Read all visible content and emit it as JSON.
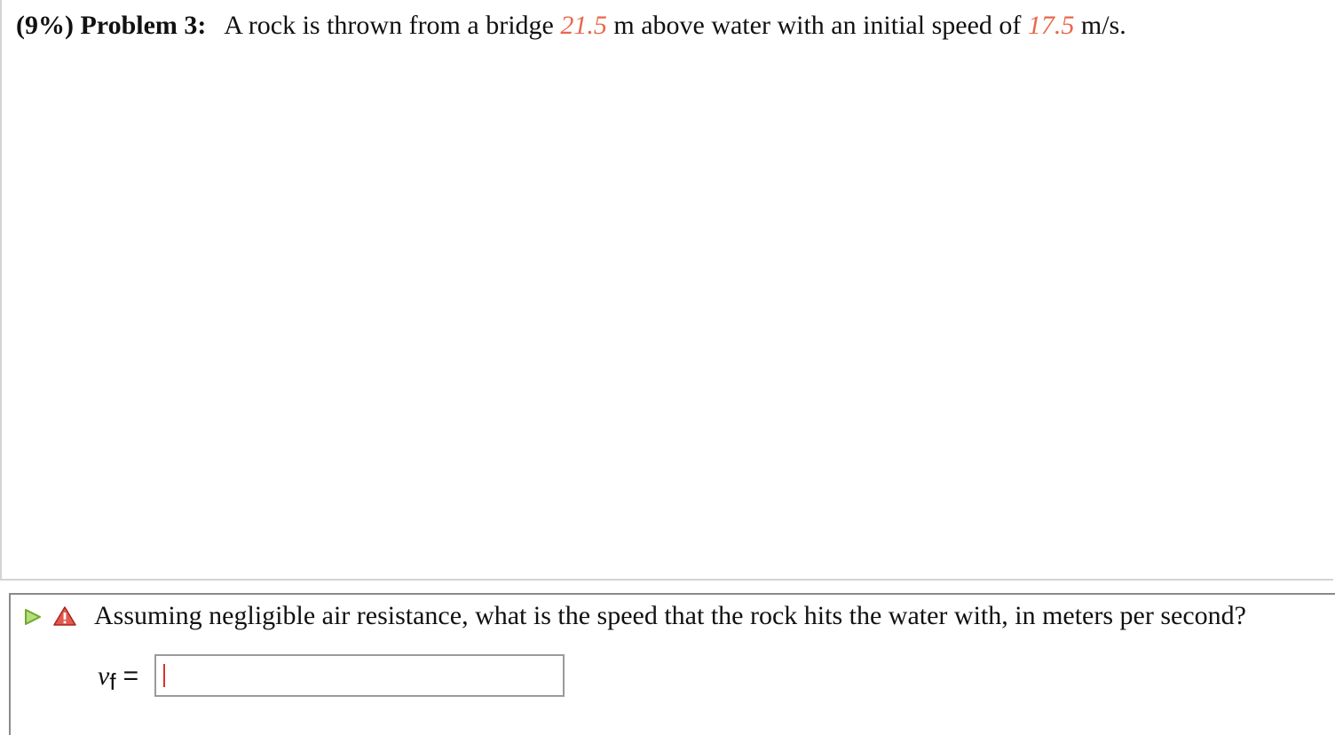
{
  "problem": {
    "weight": "(9%)",
    "label": "Problem 3:",
    "text_before_height": "A rock is thrown from a bridge",
    "height_value": "21.5",
    "text_before_speed": "m above water with an initial speed of",
    "speed_value": "17.5",
    "text_after_speed": "m/s."
  },
  "question": {
    "text": "Assuming negligible air resistance, what is the speed that the rock hits the water with, in meters per second?",
    "variable": "v",
    "variable_subscript": "f",
    "equals": "=",
    "answer_value": "",
    "icons": {
      "expand": "play-triangle-icon",
      "status": "warning-icon"
    }
  },
  "colors": {
    "given_value": "#e8674a",
    "caret": "#d9332a",
    "expand_icon": "#8cc63f",
    "warning_icon": "#d9332a"
  }
}
